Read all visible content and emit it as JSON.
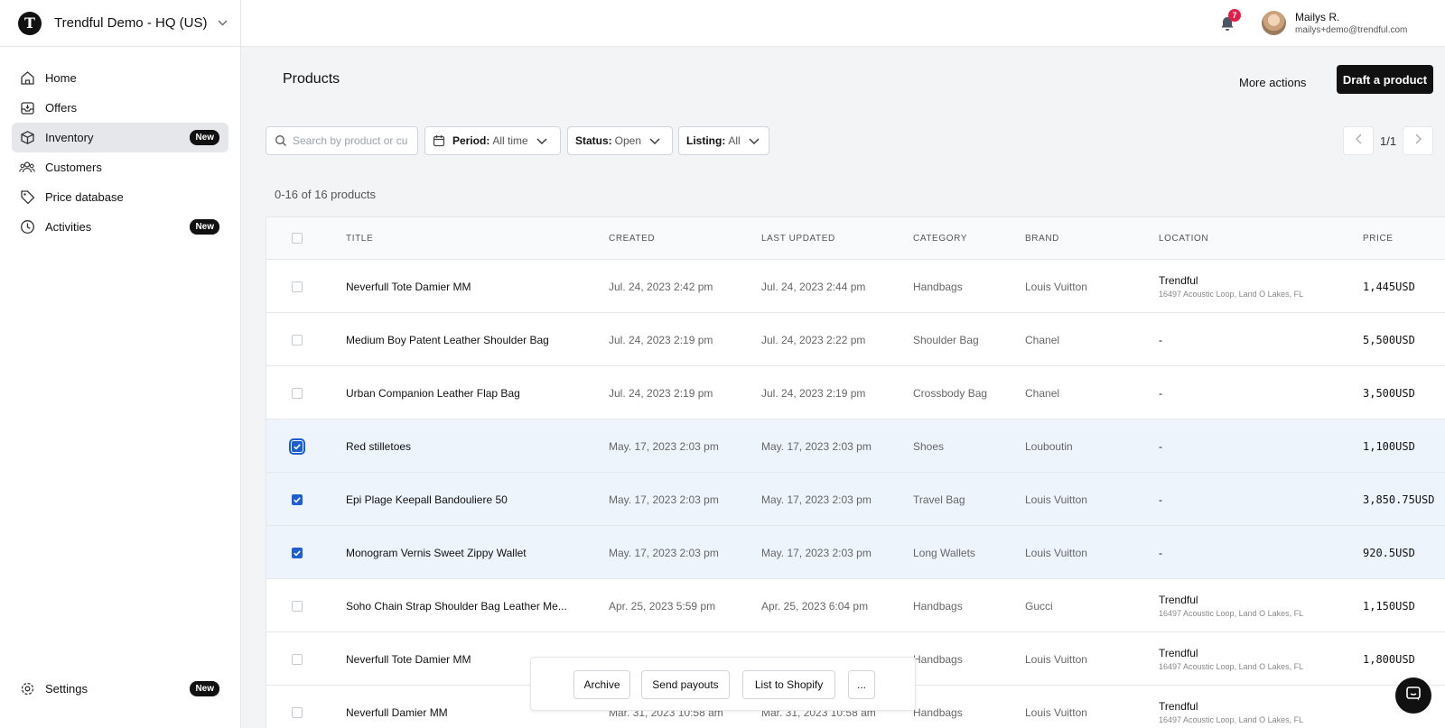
{
  "sidebar": {
    "org_name": "Trendful Demo - HQ (US)",
    "logo_letter": "T",
    "items": [
      {
        "label": "Home",
        "icon": "home-icon"
      },
      {
        "label": "Offers",
        "icon": "inbox-icon"
      },
      {
        "label": "Inventory",
        "icon": "box-icon",
        "badge": "New",
        "active": true
      },
      {
        "label": "Customers",
        "icon": "users-icon"
      },
      {
        "label": "Price database",
        "icon": "tag-icon"
      },
      {
        "label": "Activities",
        "icon": "clock-icon",
        "badge": "New"
      }
    ],
    "settings": {
      "label": "Settings",
      "icon": "gear-icon",
      "badge": "New"
    }
  },
  "header": {
    "notification_count": "7",
    "user_name": "Mailys R.",
    "user_email": "mailys+demo@trendful.com"
  },
  "page": {
    "title": "Products",
    "more_actions": "More actions",
    "draft_button": "Draft a product"
  },
  "filters": {
    "search_placeholder": "Search by product or cu",
    "period_key": "Period:",
    "period_value": "All time",
    "status_key": "Status:",
    "status_value": "Open",
    "listing_key": "Listing:",
    "listing_value": "All"
  },
  "pager": {
    "text": "1/1"
  },
  "count_text": "0-16 of 16 products",
  "table": {
    "columns": [
      "TITLE",
      "CREATED",
      "LAST UPDATED",
      "CATEGORY",
      "BRAND",
      "LOCATION",
      "PRICE"
    ],
    "rows": [
      {
        "title": "Neverfull Tote Damier MM",
        "created": "Jul. 24, 2023 2:42 pm",
        "updated": "Jul. 24, 2023 2:44 pm",
        "category": "Handbags",
        "brand": "Louis Vuitton",
        "location": "Trendful",
        "address": "16497 Acoustic Loop, Land O Lakes, FL",
        "price": "1,445",
        "currency": "USD",
        "checked": false
      },
      {
        "title": "Medium Boy Patent Leather Shoulder Bag",
        "created": "Jul. 24, 2023 2:19 pm",
        "updated": "Jul. 24, 2023 2:22 pm",
        "category": "Shoulder Bag",
        "brand": "Chanel",
        "location": "-",
        "address": "",
        "price": "5,500",
        "currency": "USD",
        "checked": false
      },
      {
        "title": "Urban Companion Leather Flap Bag",
        "created": "Jul. 24, 2023 2:19 pm",
        "updated": "Jul. 24, 2023 2:19 pm",
        "category": "Crossbody Bag",
        "brand": "Chanel",
        "location": "-",
        "address": "",
        "price": "3,500",
        "currency": "USD",
        "checked": false
      },
      {
        "title": "Red stilletoes",
        "created": "May. 17, 2023 2:03 pm",
        "updated": "May. 17, 2023 2:03 pm",
        "category": "Shoes",
        "brand": "Louboutin",
        "location": "-",
        "address": "",
        "price": "1,100",
        "currency": "USD",
        "checked": true,
        "focus": true
      },
      {
        "title": "Epi Plage Keepall Bandouliere 50",
        "created": "May. 17, 2023 2:03 pm",
        "updated": "May. 17, 2023 2:03 pm",
        "category": "Travel Bag",
        "brand": "Louis Vuitton",
        "location": "-",
        "address": "",
        "price": "3,850.75",
        "currency": "USD",
        "checked": true
      },
      {
        "title": "Monogram Vernis Sweet Zippy Wallet",
        "created": "May. 17, 2023 2:03 pm",
        "updated": "May. 17, 2023 2:03 pm",
        "category": "Long Wallets",
        "brand": "Louis Vuitton",
        "location": "-",
        "address": "",
        "price": "920.5",
        "currency": "USD",
        "checked": true
      },
      {
        "title": "Soho Chain Strap Shoulder Bag Leather Me...",
        "created": "Apr. 25, 2023 5:59 pm",
        "updated": "Apr. 25, 2023 6:04 pm",
        "category": "Handbags",
        "brand": "Gucci",
        "location": "Trendful",
        "address": "16497 Acoustic Loop, Land O Lakes, FL",
        "price": "1,150",
        "currency": "USD",
        "checked": false
      },
      {
        "title": "Neverfull Tote Damier MM",
        "created": "",
        "updated": "",
        "category": "Handbags",
        "brand": "Louis Vuitton",
        "location": "Trendful",
        "address": "16497 Acoustic Loop, Land O Lakes, FL",
        "price": "1,800",
        "currency": "USD",
        "checked": false
      },
      {
        "title": "Neverfull Damier MM",
        "created": "Mar. 31, 2023 10:58 am",
        "updated": "Mar. 31, 2023 10:58 am",
        "category": "Handbags",
        "brand": "Louis Vuitton",
        "location": "Trendful",
        "address": "16497 Acoustic Loop, Land O Lakes, FL",
        "price": "",
        "currency": "",
        "checked": false
      }
    ]
  },
  "bulk_actions": {
    "archive": "Archive",
    "send_payouts": "Send payouts",
    "list_shopify": "List to Shopify",
    "more": "..."
  },
  "colors": {
    "accent": "#1d5fd1",
    "badge": "#e11d48",
    "primary": "#111111"
  }
}
